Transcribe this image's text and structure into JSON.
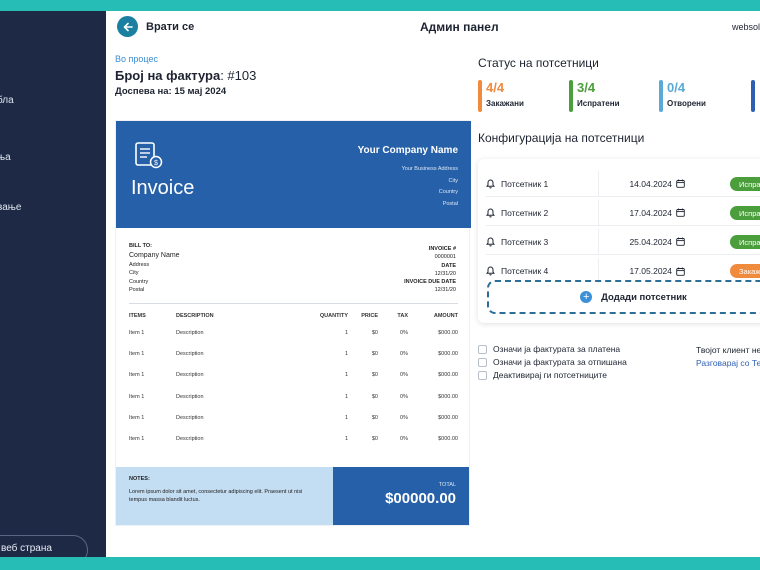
{
  "sidebar": {
    "items": [
      {
        "label": "бла",
        "icon": "table-icon"
      },
      {
        "label": "ња",
        "icon": "settings-icon"
      },
      {
        "label": "вање",
        "icon": "report-icon"
      }
    ],
    "web_label": "веб страна"
  },
  "topbar": {
    "back_label": "Врати се",
    "title": "Админ панел",
    "site": "websol"
  },
  "invoice": {
    "status": "Во процес",
    "number_label": "Број на фактура",
    "number": ": #103",
    "due": "Доспева на: 15 мај 2024",
    "doc": {
      "title": "Invoice",
      "company_name": "Your Company Name",
      "company_lines": [
        "Your Business Address",
        "City",
        "Country",
        "Postal"
      ],
      "bill_to_label": "BILL TO:",
      "bill_name": "Company Name",
      "bill_lines": [
        "Address",
        "City",
        "Country",
        "Postal"
      ],
      "meta": [
        {
          "label": "INVOICE #",
          "value": "0000001"
        },
        {
          "label": "DATE",
          "value": "12/31/20"
        },
        {
          "label": "INVOICE DUE DATE",
          "value": "12/31/20"
        }
      ],
      "columns": [
        "ITEMS",
        "DESCRIPTION",
        "QUANTITY",
        "PRICE",
        "TAX",
        "AMOUNT"
      ],
      "rows": [
        [
          "Item 1",
          "Description",
          "1",
          "$0",
          "0%",
          "$000.00"
        ],
        [
          "Item 1",
          "Description",
          "1",
          "$0",
          "0%",
          "$000.00"
        ],
        [
          "Item 1",
          "Description",
          "1",
          "$0",
          "0%",
          "$000.00"
        ],
        [
          "Item 1",
          "Description",
          "1",
          "$0",
          "0%",
          "$000.00"
        ],
        [
          "Item 1",
          "Description",
          "1",
          "$0",
          "0%",
          "$000.00"
        ],
        [
          "Item 1",
          "Description",
          "1",
          "$0",
          "0%",
          "$000.00"
        ]
      ],
      "notes_label": "NOTES:",
      "notes_text": "Lorem ipsum dolor sit amet, consectetur adipiscing elit. Praesent ut nisi tempus massa blandit luctus.",
      "total_label": "TOTAL",
      "total_amount": "$00000.00"
    }
  },
  "reminder_status": {
    "heading": "Статус на потсетници",
    "stats": [
      {
        "value": "4/4",
        "label": "Закажани",
        "color": "#f08a3c"
      },
      {
        "value": "3/4",
        "label": "Испратени",
        "color": "#4a9e3c"
      },
      {
        "value": "0/4",
        "label": "Отворени",
        "color": "#5aa9d6"
      },
      {
        "value": "",
        "label": "",
        "color": "#2f5fb3"
      }
    ]
  },
  "reminder_config": {
    "heading": "Конфигурација на потсетници",
    "reminders": [
      {
        "name": "Потсетник 1",
        "date": "14.04.2024",
        "status": "Испрате",
        "color": "#4a9e3c"
      },
      {
        "name": "Потсетник 2",
        "date": "17.04.2024",
        "status": "Испрате",
        "color": "#4a9e3c"
      },
      {
        "name": "Потсетник 3",
        "date": "25.04.2024",
        "status": "Испрате",
        "color": "#4a9e3c"
      },
      {
        "name": "Потсетник 4",
        "date": "17.05.2024",
        "status": "Закажа",
        "color": "#f08a3c"
      }
    ],
    "add_label": "Додади потсетник"
  },
  "actions": [
    "Означи ја фактурата за платена",
    "Означи ја фактурата за отпишана",
    "Деактивирај ги потсетниците"
  ],
  "client": {
    "question": "Твојот клиент не",
    "link": "Разговарај со Те"
  }
}
